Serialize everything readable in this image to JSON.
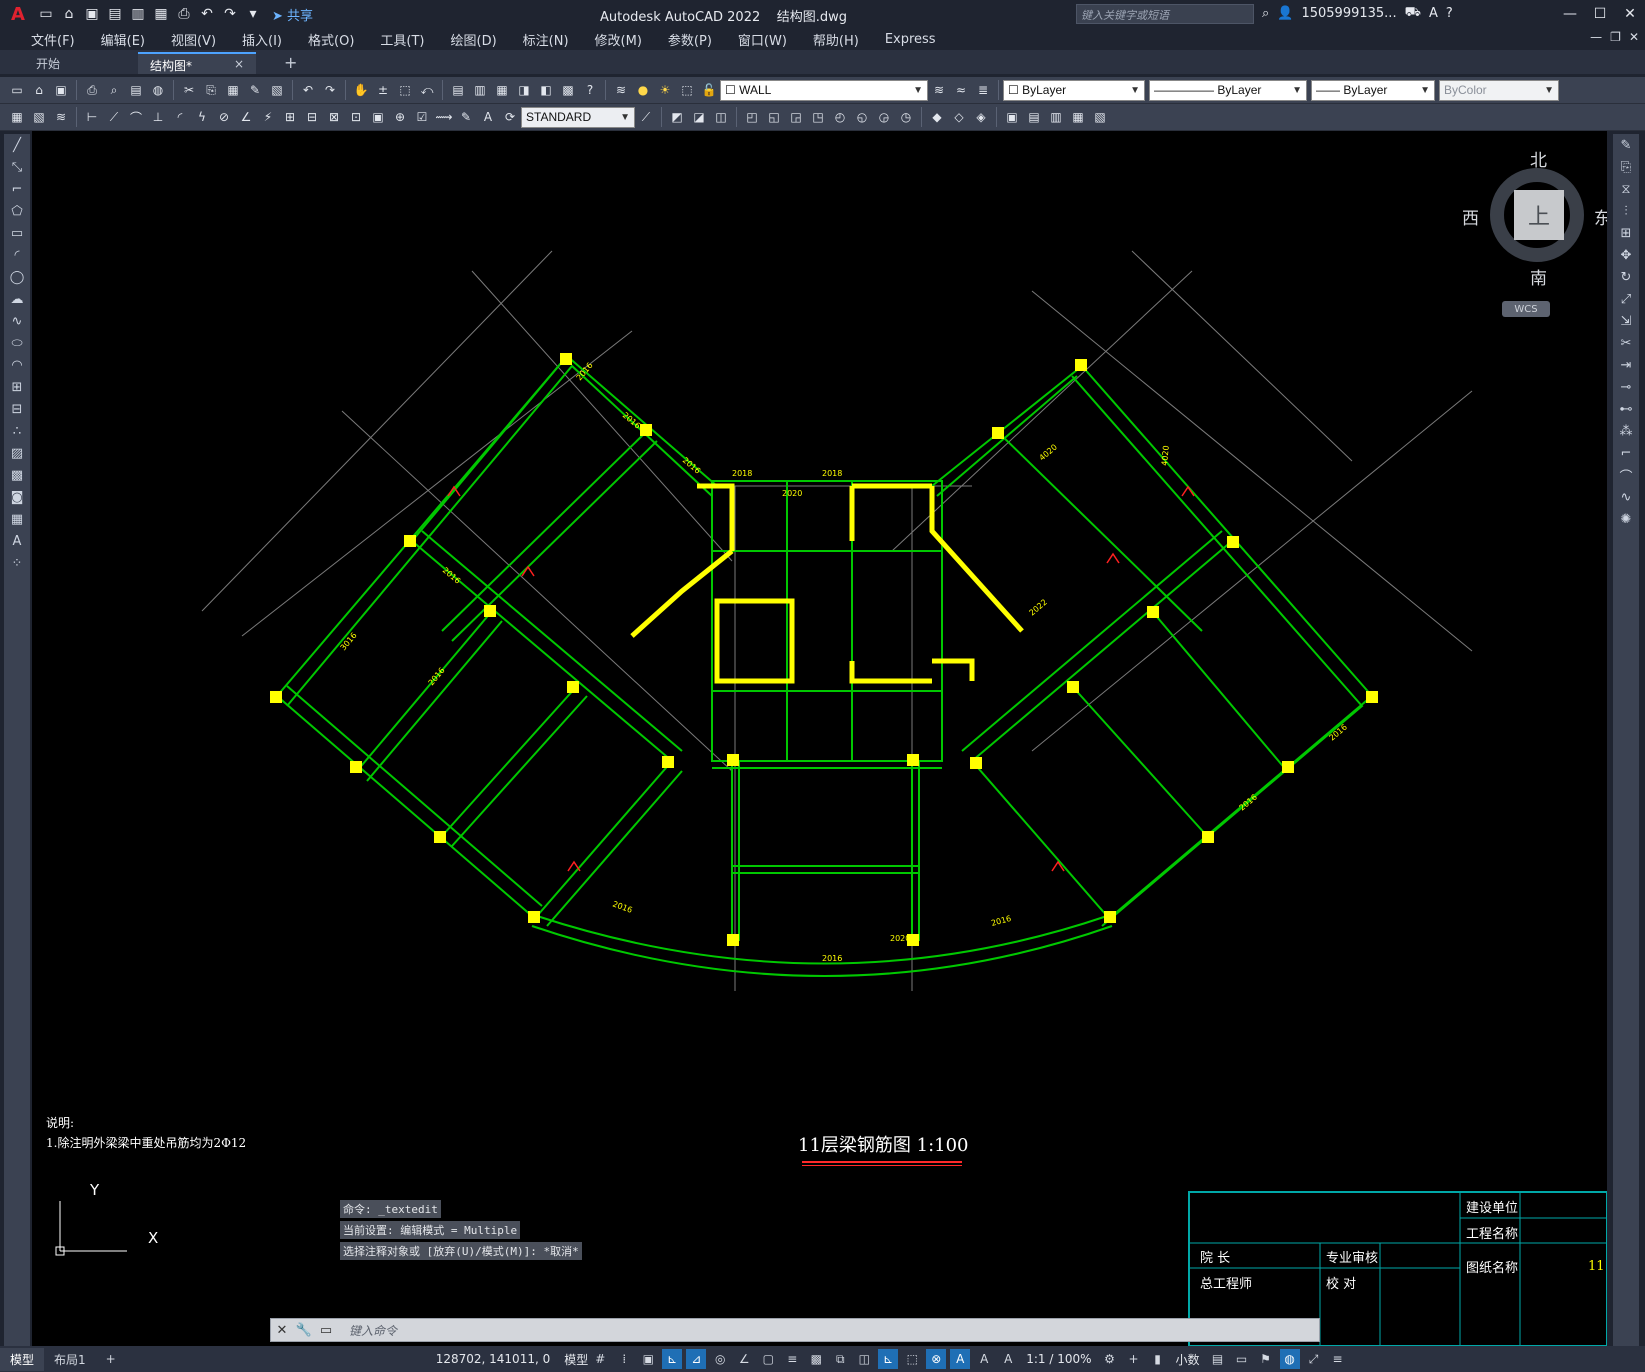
{
  "app": {
    "title": "Autodesk AutoCAD 2022",
    "filename": "结构图.dwg",
    "share_label": "共享",
    "search_placeholder": "键入关键字或短语",
    "user": "1505999135...",
    "logo": "A"
  },
  "menu": [
    "文件(F)",
    "编辑(E)",
    "视图(V)",
    "插入(I)",
    "格式(O)",
    "工具(T)",
    "绘图(D)",
    "标注(N)",
    "修改(M)",
    "参数(P)",
    "窗口(W)",
    "帮助(H)",
    "Express"
  ],
  "tabs": {
    "start": "开始",
    "active": "结构图*",
    "close": "×",
    "add": "+"
  },
  "toolbar": {
    "layer": "WALL",
    "color": "ByLayer",
    "linetype": "ByLayer",
    "lineweight": "ByLayer",
    "plotstyle": "ByColor",
    "dimstyle": "STANDARD"
  },
  "viewcube": {
    "north": "北",
    "south": "南",
    "east": "东",
    "west": "西",
    "face": "上",
    "wcs": "WCS"
  },
  "drawing": {
    "note_heading": "说明:",
    "note_line": "1.除注明外梁梁中重处吊筋均为2Φ12",
    "title": "11层梁钢筋图  1:100",
    "ucs_y": "Y",
    "ucs_x": "X",
    "annotations_2016": "2016",
    "annotations_2018": "2018",
    "annotations_2020": "2020",
    "annotations_3016": "3016",
    "annotations_4020": "4020",
    "annotations_2022": "2022"
  },
  "titleblock": {
    "builder": "建设单位",
    "project": "工程名称",
    "drawing_name": "图纸名称",
    "dean": "院    长",
    "chief": "总工程师",
    "review": "专业审核",
    "check": "校    对",
    "number": "11"
  },
  "command": {
    "history": [
      "命令: _textedit",
      "当前设置: 编辑模式 = Multiple",
      "选择注释对象或 [放弃(U)/模式(M)]: *取消*"
    ],
    "placeholder": "键入命令"
  },
  "status": {
    "tab_model": "模型",
    "tab_layout": "布局1",
    "add": "+",
    "coords": "128702, 141011, 0",
    "mode": "模型",
    "scale": "1:1 / 100%",
    "units": "小数"
  },
  "colors": {
    "beam": "#00c800",
    "label": "#ffff00",
    "column": "#ffff00",
    "grid": "#8a8a8a",
    "accent": "#1f6fb5"
  }
}
